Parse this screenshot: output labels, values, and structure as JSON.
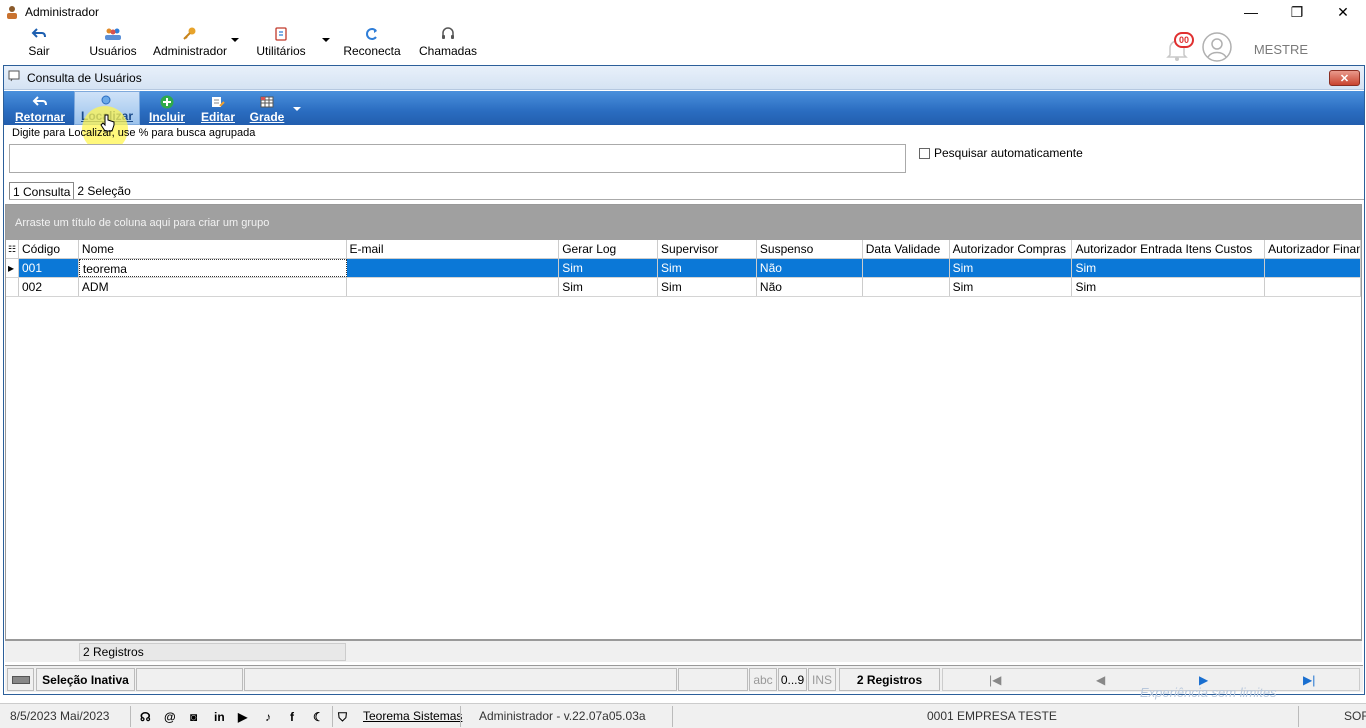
{
  "window": {
    "title": "Administrador",
    "minimize": "—",
    "maximize": "❐",
    "close": "✕"
  },
  "main_toolbar": {
    "items": [
      {
        "label": "Sair",
        "icon": "back-arrow-icon"
      },
      {
        "label": "Usuários",
        "icon": "users-icon"
      },
      {
        "label": "Administrador",
        "icon": "key-icon"
      },
      {
        "label": "Utilitários",
        "icon": "tools-icon"
      },
      {
        "label": "Reconecta",
        "icon": "refresh-icon"
      },
      {
        "label": "Chamadas",
        "icon": "headset-icon"
      }
    ],
    "notifications_count": "00",
    "user": "MESTRE"
  },
  "child_window": {
    "title": "Consulta de Usuários",
    "toolbar": [
      {
        "label": "Retornar",
        "icon": "back-arrow-icon"
      },
      {
        "label": "Localizar",
        "icon": "search-icon"
      },
      {
        "label": "Incluir",
        "icon": "plus-icon"
      },
      {
        "label": "Editar",
        "icon": "edit-icon"
      },
      {
        "label": "Grade",
        "icon": "grid-icon"
      }
    ],
    "search": {
      "hint": "Digite para Localizar, use % para busca agrupada",
      "value": "",
      "auto_search_label": "Pesquisar automaticamente",
      "auto_search_checked": false
    },
    "tabs": [
      {
        "label": "1 Consulta"
      },
      {
        "label": "2 Seleção"
      }
    ],
    "grid": {
      "group_hint": "Arraste um título de coluna aqui para criar um grupo",
      "columns": [
        "Código",
        "Nome",
        "E-mail",
        "Gerar Log",
        "Supervisor",
        "Suspenso",
        "Data Validade",
        "Autorizador Compras",
        "Autorizador Entrada Itens Custos",
        "Autorizador Financeiro"
      ],
      "rows": [
        [
          "001",
          "teorema",
          "",
          "Sim",
          "Sim",
          "Não",
          "",
          "Sim",
          "Sim",
          ""
        ],
        [
          "002",
          "ADM",
          "",
          "Sim",
          "Sim",
          "Não",
          "",
          "Sim",
          "Sim",
          ""
        ]
      ],
      "footer_count": "2 Registros"
    },
    "statusbar": {
      "selection": "Seleção Inativa",
      "abc": "abc",
      "digits": "0...9",
      "ins": "INS",
      "count": "2 Registros",
      "nav_first": "|◀",
      "nav_prev": "◀",
      "nav_next": "▶",
      "nav_last": "▶|"
    }
  },
  "bottom_bar": {
    "date": "8/5/2023 Mai/2023",
    "company_link": "Teorema Sistemas",
    "user_version": "Administrador - v.22.07a05.03a",
    "company": "0001 EMPRESA TESTE",
    "right_text": "SOF",
    "faded_text": "Experiência sem limites"
  },
  "colors": {
    "accent": "#2a6cc0",
    "selection": "#0b78d7",
    "group_panel": "#a0a0a0"
  }
}
